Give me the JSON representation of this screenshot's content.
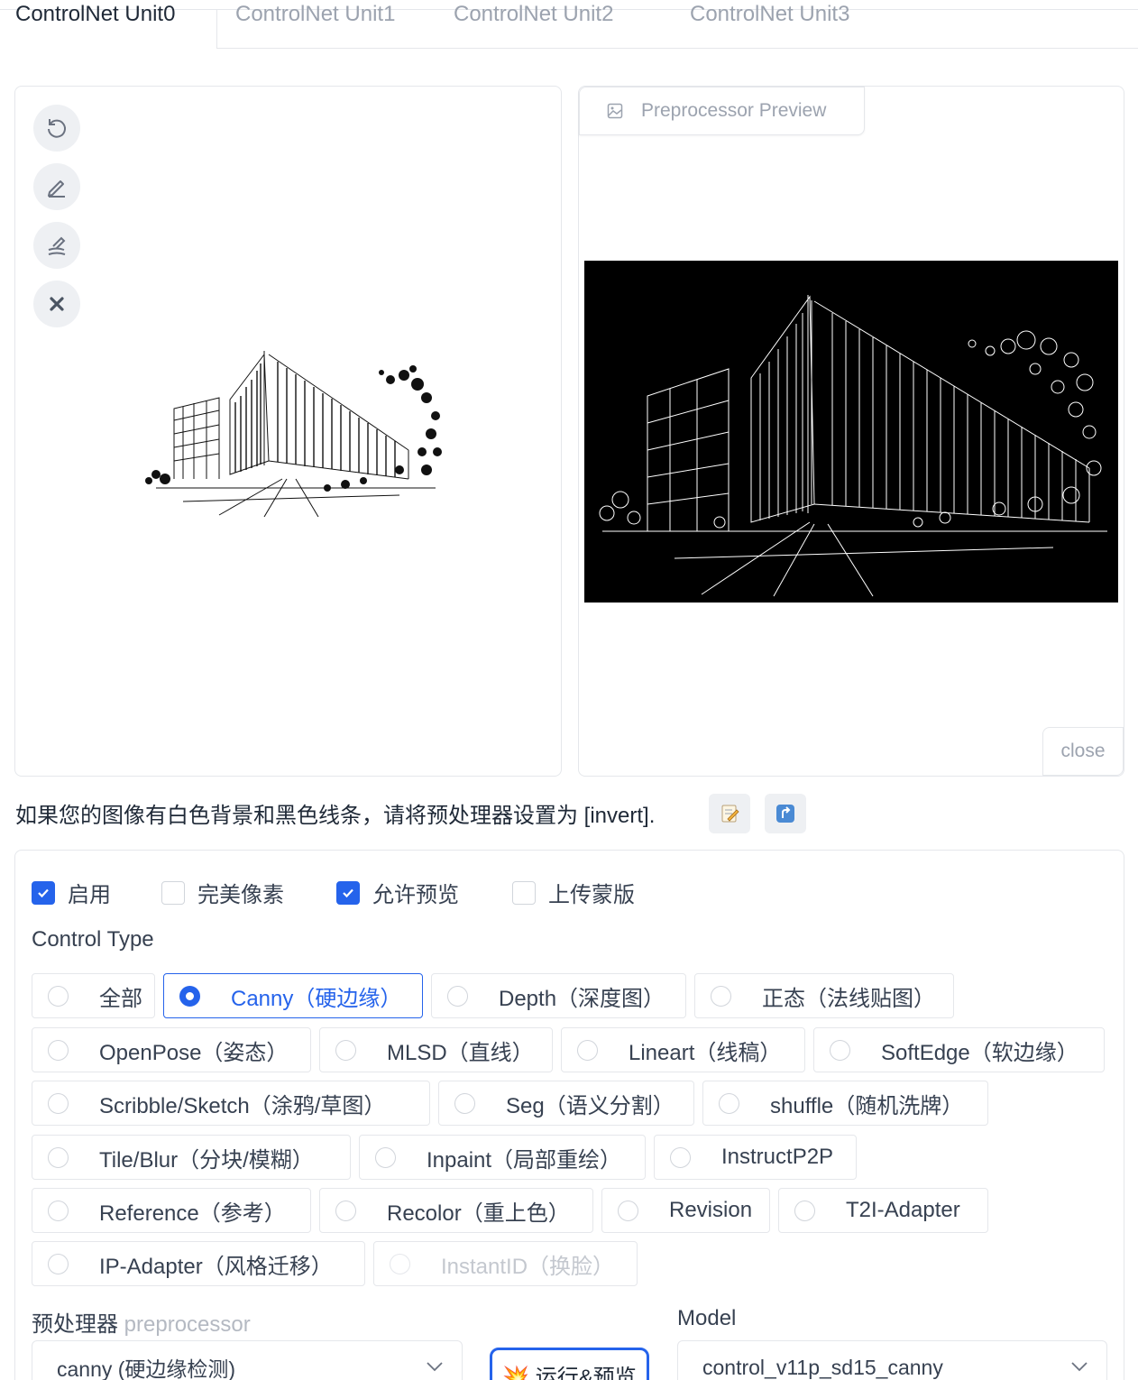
{
  "tabs": [
    {
      "label": "ControlNet Unit0",
      "active": true
    },
    {
      "label": "ControlNet Unit1",
      "active": false
    },
    {
      "label": "ControlNet Unit2",
      "active": false
    },
    {
      "label": "ControlNet Unit3",
      "active": false
    }
  ],
  "image_editor": {
    "tools": [
      "undo-icon",
      "pencil-icon",
      "brush-icon",
      "close-icon"
    ]
  },
  "preview": {
    "label": "Preprocessor Preview",
    "close_label": "close"
  },
  "hint": {
    "text": "如果您的图像有白色背景和黑色线条，请将预处理器设置为 [invert].",
    "buttons": [
      "📝",
      "⤴️"
    ]
  },
  "options": {
    "enable": {
      "label": "启用",
      "checked": true
    },
    "pixel_perfect": {
      "label": "完美像素",
      "checked": false
    },
    "allow_preview": {
      "label": "允许预览",
      "checked": true
    },
    "upload_mask": {
      "label": "上传蒙版",
      "checked": false
    }
  },
  "control_type": {
    "label": "Control Type",
    "selected": "Canny（硬边缘）",
    "items": [
      "全部",
      "Canny（硬边缘）",
      "Depth（深度图）",
      "正态（法线贴图）",
      "OpenPose（姿态）",
      "MLSD（直线）",
      "Lineart（线稿）",
      "SoftEdge（软边缘）",
      "Scribble/Sketch（涂鸦/草图）",
      "Seg（语义分割）",
      "shuffle（随机洗牌）",
      "Tile/Blur（分块/模糊）",
      "Inpaint（局部重绘）",
      "InstructP2P",
      "Reference（参考）",
      "Recolor（重上色）",
      "Revision",
      "T2I-Adapter",
      "IP-Adapter（风格迁移）",
      "InstantID（换脸）"
    ]
  },
  "preprocessor": {
    "label": "预处理器",
    "sublabel": "preprocessor",
    "value": "canny (硬边缘检测)",
    "run_label": "💥 运行&预览"
  },
  "model": {
    "label": "Model",
    "value": "control_v11p_sd15_canny"
  },
  "colors": {
    "accent": "#2563eb",
    "border": "#e5e7eb",
    "muted_text": "#9ca3af"
  }
}
